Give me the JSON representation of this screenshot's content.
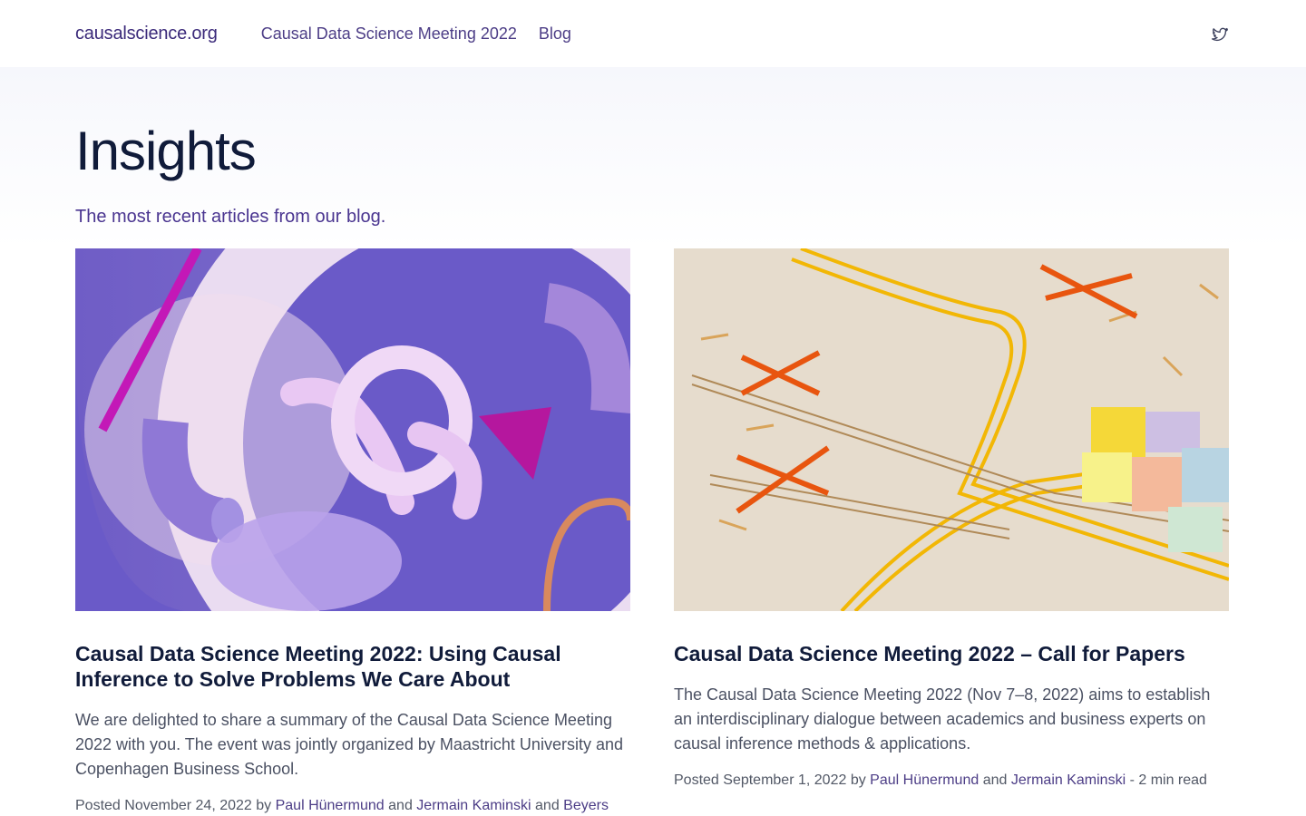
{
  "nav": {
    "brand": "causalscience.org",
    "links": [
      "Causal Data Science Meeting 2022",
      "Blog"
    ],
    "social_icon": "twitter-icon"
  },
  "hero": {
    "title": "Insights",
    "subtitle": "The most recent articles from our blog."
  },
  "articles": [
    {
      "title": "Causal Data Science Meeting 2022: Using Causal Inference to Solve Problems We Care About",
      "excerpt": "We are delighted to share a summary of the Causal Data Science Meeting 2022 with you. The event was jointly organized by Maastricht University and Copenhagen Business School.",
      "posted_label": "Posted",
      "date": "November 24, 2022",
      "by": "by",
      "authors": [
        "Paul Hünermund",
        "Jermain Kaminski",
        "Beyers"
      ],
      "and": "and"
    },
    {
      "title": "Causal Data Science Meeting 2022 – Call for Papers",
      "excerpt": "The Causal Data Science Meeting 2022 (Nov 7–8, 2022) aims to establish an interdisciplinary dialogue between academics and business experts on causal inference methods & applications.",
      "posted_label": "Posted",
      "date": "September 1, 2022",
      "by": "by",
      "authors": [
        "Paul Hünermund",
        "Jermain Kaminski"
      ],
      "and": "and",
      "read_time": "- 2 min read"
    }
  ],
  "colors": {
    "brand": "#3b2a7a",
    "heading": "#101b3a",
    "accent": "#4a3590"
  }
}
